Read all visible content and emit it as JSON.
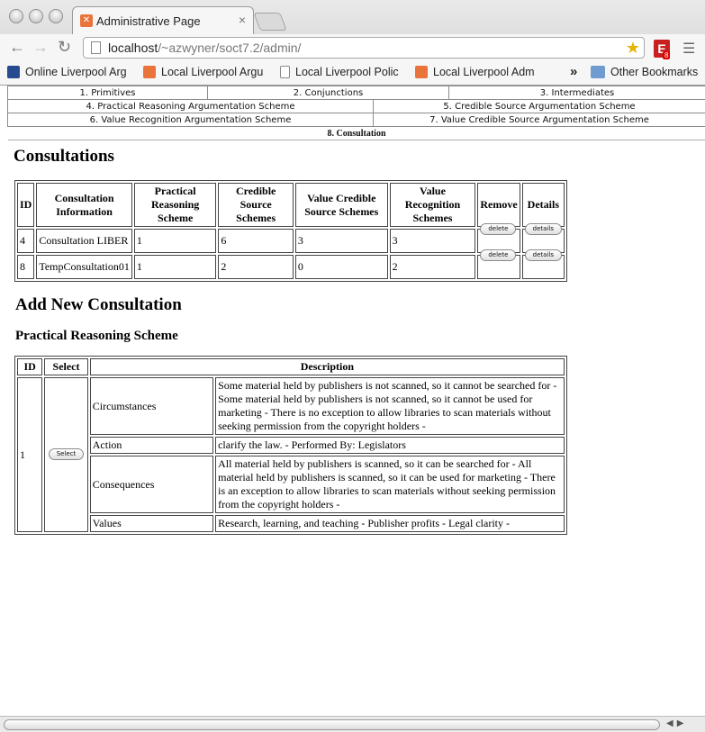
{
  "browser": {
    "tab_title": "Administrative Page",
    "url_host": "localhost",
    "url_path": "/~azwyner/soct7.2/admin/",
    "extension_badge": "8",
    "bookmarks": [
      {
        "label": "Online Liverpool Arg",
        "icon": "bird-icon"
      },
      {
        "label": "Local Liverpool Argu",
        "icon": "xampp-icon"
      },
      {
        "label": "Local Liverpool Polic",
        "icon": "page-icon"
      },
      {
        "label": "Local Liverpool Adm",
        "icon": "xampp-icon"
      }
    ],
    "other_bookmarks": "Other Bookmarks"
  },
  "nav": {
    "row1": [
      "1. Primitives",
      "2. Conjunctions",
      "3. Intermediates"
    ],
    "row2": [
      "4. Practical Reasoning Argumentation Scheme",
      "5. Credible Source Argumentation Scheme"
    ],
    "row3": [
      "6. Value Recognition Argumentation Scheme",
      "7. Value Credible Source Argumentation Scheme"
    ],
    "row4": "8. Consultation"
  },
  "consultations": {
    "heading": "Consultations",
    "headers": [
      "ID",
      "Consultation Information",
      "Practical Reasoning Scheme",
      "Credible Source Schemes",
      "Value Credible Source Schemes",
      "Value Recognition Schemes",
      "Remove",
      "Details"
    ],
    "rows": [
      {
        "id": "4",
        "info": "Consultation LIBER",
        "pr": "1",
        "cs": "6",
        "vcs": "3",
        "vr": "3"
      },
      {
        "id": "8",
        "info": "TempConsultation01",
        "pr": "1",
        "cs": "2",
        "vcs": "0",
        "vr": "2"
      }
    ],
    "delete_label": "delete",
    "details_label": "details"
  },
  "add_new": {
    "heading": "Add New Consultation",
    "subheading": "Practical Reasoning Scheme",
    "headers": [
      "ID",
      "Select",
      "Description"
    ],
    "id": "1",
    "select_label": "Select",
    "rows": [
      {
        "label": "Circumstances",
        "text": "Some material held by publishers is not scanned, so it cannot be searched for - Some material held by publishers is not scanned, so it cannot be used for marketing - There is no exception to allow libraries to scan materials without seeking permission from the copyright holders -"
      },
      {
        "label": "Action",
        "text": "clarify the law. - Performed By: Legislators"
      },
      {
        "label": "Consequences",
        "text": "All material held by publishers is scanned, so it can be searched for - All material held by publishers is scanned, so it can be used for marketing - There is an exception to allow libraries to scan materials without seeking permission from the copyright holders -"
      },
      {
        "label": "Values",
        "text": "Research, learning, and teaching - Publisher profits - Legal clarity -"
      }
    ]
  }
}
